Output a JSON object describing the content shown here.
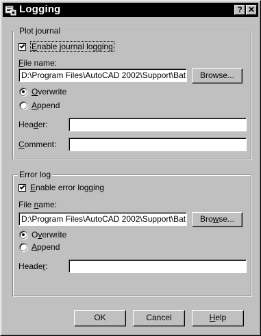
{
  "window": {
    "title": "Logging",
    "help_label": "?",
    "close_label": "✕"
  },
  "plot_journal": {
    "group_title": "Plot journal",
    "enable_label_underline": "E",
    "enable_label_rest": "nable journal logging",
    "enable_checked": true,
    "file_name_label_underline": "F",
    "file_name_label_rest": "ile name:",
    "file_name_value": "D:\\Program Files\\AutoCAD 2002\\Support\\Bat",
    "browse_label": "Browse...",
    "overwrite_underline": "O",
    "overwrite_rest": "verwrite",
    "overwrite_selected": true,
    "append_underline": "A",
    "append_rest": "ppend",
    "append_selected": false,
    "header_label_pre": "Hea",
    "header_label_underline": "d",
    "header_label_post": "er:",
    "header_value": "",
    "comment_label_underline": "C",
    "comment_label_rest": "omment:",
    "comment_value": ""
  },
  "error_log": {
    "group_title": "Error log",
    "enable_label_underline": "E",
    "enable_label_rest": "nable error logging",
    "enable_checked": true,
    "file_name_label_pre": "File ",
    "file_name_label_underline": "n",
    "file_name_label_post": "ame:",
    "file_name_value": "D:\\Program Files\\AutoCAD 2002\\Support\\Bat",
    "browse_label_pre": "Bro",
    "browse_label_underline": "w",
    "browse_label_post": "se...",
    "overwrite_pre": "O",
    "overwrite_underline": "v",
    "overwrite_post": "erwrite",
    "overwrite_selected": true,
    "append_underline": "A",
    "append_rest": "ppend",
    "append_selected": false,
    "header_label_pre": "Heade",
    "header_label_underline": "r",
    "header_label_post": ":",
    "header_value": ""
  },
  "footer": {
    "ok_label": "OK",
    "cancel_label": "Cancel",
    "help_label_underline": "H",
    "help_label_rest": "elp"
  }
}
